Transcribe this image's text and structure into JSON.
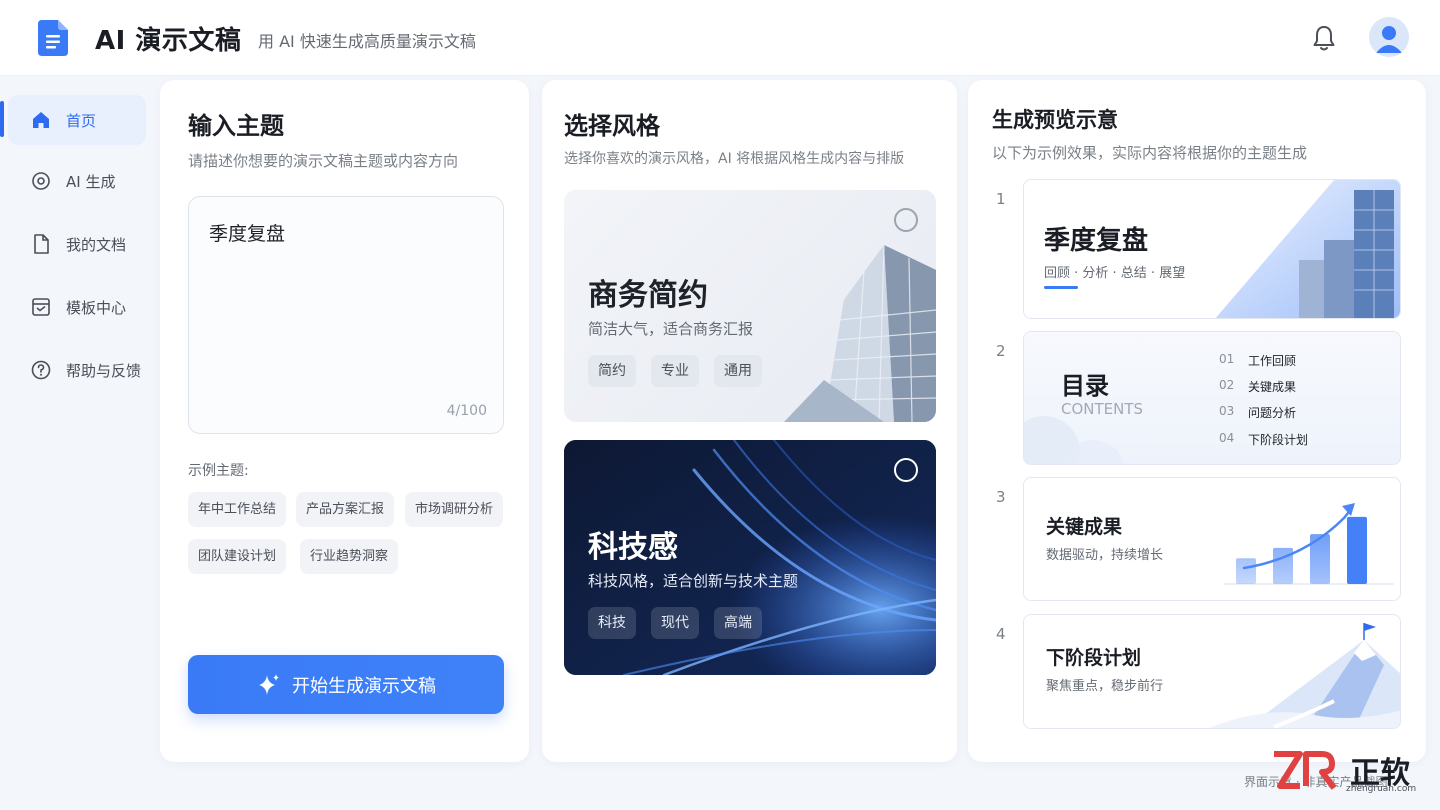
{
  "header": {
    "title": "AI 演示文稿",
    "subtitle": "用 AI 快速生成高质量演示文稿",
    "logo_icon": "document-icon",
    "notification_icon": "bell-icon",
    "avatar_icon": "user-avatar-icon",
    "accent_color": "#2f6bf0"
  },
  "sidebar": {
    "items": [
      {
        "label": "首页",
        "icon": "home-icon",
        "active": true
      },
      {
        "label": "AI 生成",
        "icon": "ai-target-icon",
        "active": false
      },
      {
        "label": "我的文档",
        "icon": "file-icon",
        "active": false
      },
      {
        "label": "模板中心",
        "icon": "template-icon",
        "active": false
      },
      {
        "label": "帮助与反馈",
        "icon": "help-icon",
        "active": false
      }
    ]
  },
  "input_panel": {
    "title": "输入主题",
    "description": "请描述你想要的演示文稿主题或内容方向",
    "topic_value": "季度复盘",
    "char_count": "4/100",
    "examples_label": "示例主题:",
    "examples": [
      "年中工作总结",
      "产品方案汇报",
      "市场调研分析",
      "团队建设计划",
      "行业趋势洞察"
    ],
    "generate_label": "开始生成演示文稿",
    "generate_icon": "sparkle-icon"
  },
  "style_panel": {
    "title": "选择风格",
    "description": "选择你喜欢的演示风格，AI 将根据风格生成内容与排版",
    "styles": [
      {
        "name": "商务简约",
        "subtitle": "简洁大气，适合商务汇报",
        "tags": [
          "简约",
          "专业",
          "通用"
        ],
        "selected": false
      },
      {
        "name": "科技感",
        "subtitle": "科技风格，适合创新与技术主题",
        "tags": [
          "科技",
          "现代",
          "高端"
        ],
        "selected": false
      }
    ]
  },
  "preview_panel": {
    "title": "生成预览示意",
    "description": "以下为示例效果，实际内容将根据你的主题生成",
    "slides": [
      {
        "num": "1",
        "title": "季度复盘",
        "subtitle": "回顾 · 分析 · 总结 · 展望"
      },
      {
        "num": "2",
        "title": "目录",
        "subtitle": "CONTENTS",
        "toc": [
          {
            "num": "01",
            "text": "工作回顾"
          },
          {
            "num": "02",
            "text": "关键成果"
          },
          {
            "num": "03",
            "text": "问题分析"
          },
          {
            "num": "04",
            "text": "下阶段计划"
          }
        ]
      },
      {
        "num": "3",
        "title": "关键成果",
        "subtitle": "数据驱动，持续增长",
        "bar_levels": [
          0.3,
          0.42,
          0.58,
          0.78
        ]
      },
      {
        "num": "4",
        "title": "下阶段计划",
        "subtitle": "聚焦重点，稳步前行"
      }
    ]
  },
  "footer": {
    "watermark": "界面示意 · 非真实产品截图",
    "brand_text": "正软",
    "brand_url": "zhengruan.com"
  }
}
